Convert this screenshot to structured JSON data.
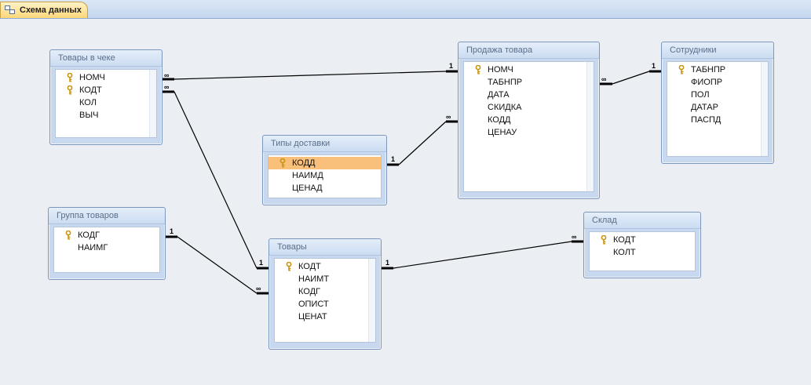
{
  "tab": {
    "label": "Схема данных"
  },
  "tables": {
    "tovary_v_cheke": {
      "title": "Товары в чеке",
      "fields": [
        "НОМЧ",
        "КОДТ",
        "КОЛ",
        "ВЫЧ"
      ]
    },
    "prodazha": {
      "title": "Продажа товара",
      "fields": [
        "НОМЧ",
        "ТАБНПР",
        "ДАТА",
        "СКИДКА",
        "КОДД",
        "ЦЕНАУ"
      ]
    },
    "sotrudniki": {
      "title": "Сотрудники",
      "fields": [
        "ТАБНПР",
        "ФИОПР",
        "ПОЛ",
        "ДАТАР",
        "ПАСПД"
      ]
    },
    "tipy_dostavki": {
      "title": "Типы доставки",
      "fields": [
        "КОДД",
        "НАИМД",
        "ЦЕНАД"
      ]
    },
    "gruppa": {
      "title": "Группа товаров",
      "fields": [
        "КОДГ",
        "НАИМГ"
      ]
    },
    "tovary": {
      "title": "Товары",
      "fields": [
        "КОДТ",
        "НАИМТ",
        "КОДГ",
        "ОПИСТ",
        "ЦЕНАТ"
      ]
    },
    "sklad": {
      "title": "Склад",
      "fields": [
        "КОДТ",
        "КОЛТ"
      ]
    }
  },
  "cardinality": {
    "one": "1",
    "many": "∞"
  },
  "colors": {
    "selected_row": "#f8c07a",
    "key": "#d4a017"
  }
}
